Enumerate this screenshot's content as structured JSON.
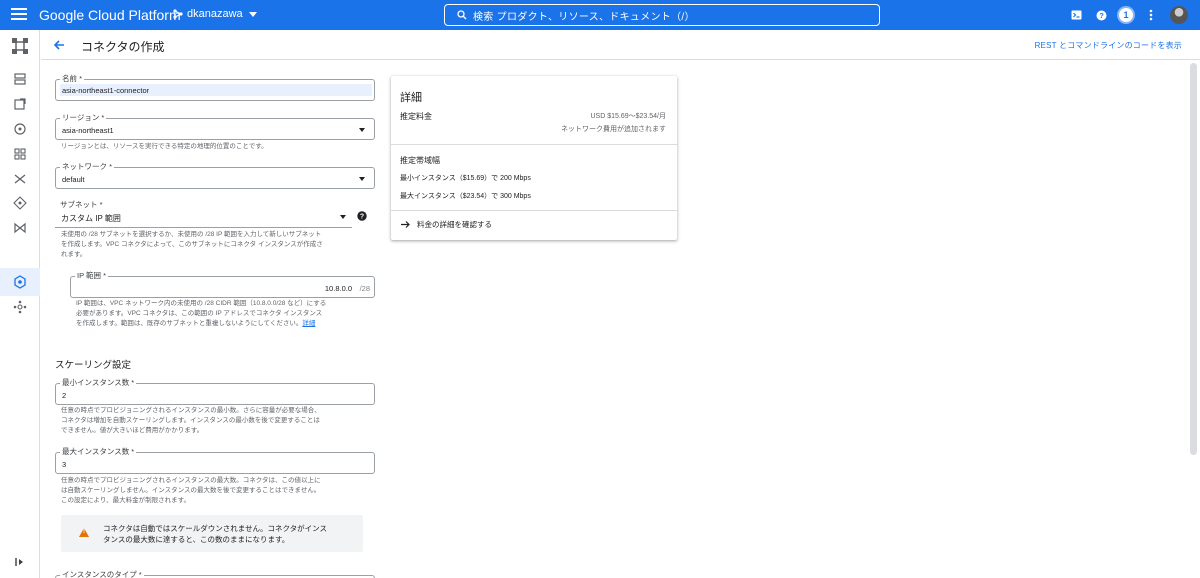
{
  "topbar": {
    "brand": "Google Cloud Platform",
    "project": "dkanazawa",
    "search_placeholder": "検索  プロダクト、リソース、ドキュメント（/）",
    "notification_count": "1"
  },
  "subheader": {
    "title": "コネクタの作成",
    "rest_link": "REST とコマンドラインのコードを表示"
  },
  "form": {
    "name": {
      "label": "名前 *",
      "value": "asia-northeast1-connector"
    },
    "region": {
      "label": "リージョン *",
      "value": "asia-northeast1",
      "hint": "リージョンとは、リソースを実行できる特定の地理的位置のことです。"
    },
    "network": {
      "label": "ネットワーク *",
      "value": "default"
    },
    "subnet": {
      "label": "サブネット *",
      "value": "カスタム IP 範囲",
      "hint_line1": "未使用の /28 サブネットを選択するか、未使用の /28 IP 範囲を入力して新しいサブネット",
      "hint_line2": "を作成します。VPC コネクタによって、このサブネットにコネクタ インスタンスが作成さ",
      "hint_line3": "れます。"
    },
    "ip_range": {
      "label": "IP 範囲 *",
      "value": "10.8.0.0",
      "suffix": "/28",
      "hint_line1": "IP 範囲は、VPC ネットワーク内の未使用の /28 CIDR 範囲（10.8.0.0/28 など）にする",
      "hint_line2": "必要があります。VPC コネクタは、この範囲の IP アドレスでコネクタ インスタンス",
      "hint_line3": "を作成します。範囲は、既存のサブネットと重複しないようにしてください。",
      "hint_link": "詳細"
    },
    "scaling_title": "スケーリング設定",
    "min_instances": {
      "label": "最小インスタンス数 *",
      "value": "2",
      "hint_line1": "任意の時点でプロビジョニングされるインスタンスの最小数。さらに容量が必要な場合、",
      "hint_line2": "コネクタは増加を自動スケーリングします。インスタンスの最小数を後で変更することは",
      "hint_line3": "できません。値が大きいほど費用がかかります。"
    },
    "max_instances": {
      "label": "最大インスタンス数 *",
      "value": "3",
      "hint_line1": "任意の時点でプロビジョニングされるインスタンスの最大数。コネクタは、この値以上に",
      "hint_line2": "は自動スケーリングしません。インスタンスの最大数を後で変更することはできません。",
      "hint_line3": "この設定により、最大料金が制限されます。"
    },
    "warning_line1": "コネクタは自動ではスケールダウンされません。コネクタがインス",
    "warning_line2": "タンスの最大数に達すると、この数のままになります。",
    "instance_type_label": "インスタンスのタイプ *"
  },
  "details": {
    "title": "詳細",
    "cost_label": "推定料金",
    "cost_range": "USD $15.69～$23.54/月",
    "cost_note": "ネットワーク費用が追加されます",
    "bandwidth_title": "推定帯域幅",
    "min_row": "最小インスタンス（$15.69）で 200 Mbps",
    "max_row": "最大インスタンス（$23.54）で 300 Mbps",
    "pricing_link": "料金の詳細を確認する"
  },
  "colors": {
    "brand_blue": "#1a73e8",
    "warning": "#e37400"
  }
}
